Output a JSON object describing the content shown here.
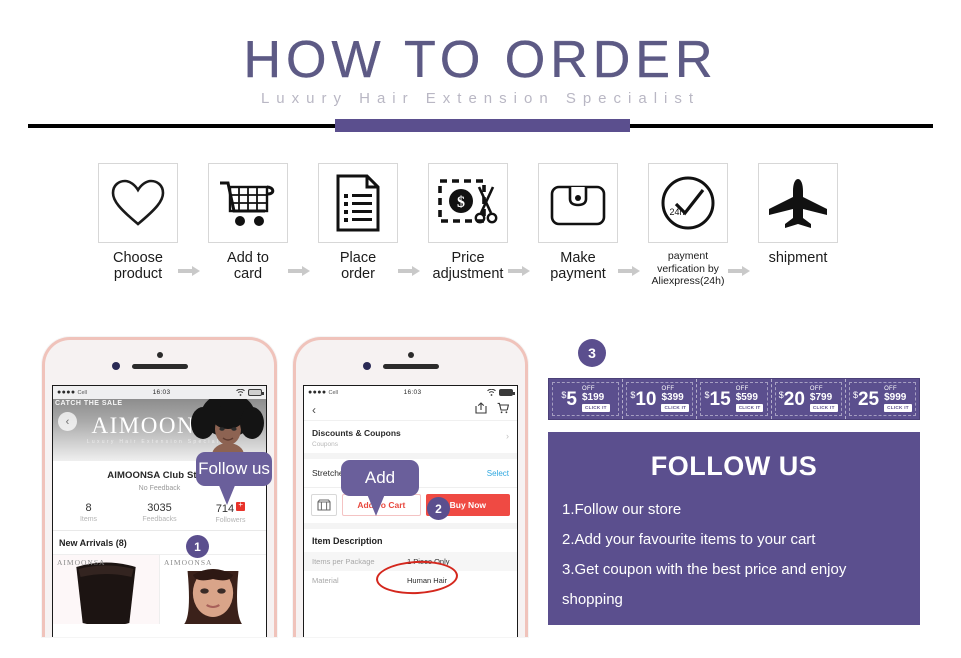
{
  "header": {
    "title": "HOW TO ORDER",
    "subtitle": "Luxury Hair Extension Specialist"
  },
  "steps": [
    {
      "icon": "heart-icon",
      "label_line1": "Choose",
      "label_line2": "product"
    },
    {
      "icon": "shopping-cart-icon",
      "label_line1": "Add to",
      "label_line2": "card"
    },
    {
      "icon": "document-icon",
      "label_line1": "Place",
      "label_line2": "order"
    },
    {
      "icon": "price-cut-icon",
      "label_line1": "Price",
      "label_line2": "adjustment"
    },
    {
      "icon": "wallet-icon",
      "label_line1": "Make",
      "label_line2": "payment"
    },
    {
      "icon": "clock-check-icon",
      "label_line1": "payment",
      "label_line2": "verfication by",
      "label_line3": "Aliexpress(24h)",
      "badge": "24h"
    },
    {
      "icon": "airplane-icon",
      "label_line1": "shipment",
      "label_line2": ""
    }
  ],
  "phone1": {
    "status": {
      "carrier": "Cell",
      "time": "16:03",
      "signal_dots": "●●●●"
    },
    "sale_tag": "CATCH THE SALE",
    "store_banner_name": "AIMOONSA",
    "store_banner_sub": "Luxury Hair Extension Specialist",
    "store_title": "AIMOONSA Club Store",
    "feedback": "No Feedback",
    "stats": [
      {
        "value": "8",
        "label": "Items"
      },
      {
        "value": "3035",
        "label": "Feedbacks"
      },
      {
        "value": "714",
        "label": "Followers",
        "badge": "+"
      }
    ],
    "arrivals": "New Arrivals (8)",
    "watermark": "AIMOONSA",
    "bubble": "Follow us",
    "badge": "1"
  },
  "phone2": {
    "status": {
      "carrier": "Cell",
      "time": "16:03",
      "signal_dots": "●●●●"
    },
    "coupons_title": "Discounts & Coupons",
    "coupons_sub": "Coupons",
    "stretched_label": "Stretched Length",
    "select_label": "Select",
    "add_to_cart": "Add To Cart",
    "buy_now": "Buy Now",
    "desc_title": "Item Description",
    "desc_rows": [
      {
        "key": "Items per Package",
        "value": "1 Piece Only"
      },
      {
        "key": "Material",
        "value": "Human Hair"
      }
    ],
    "bubble": "Add",
    "badge": "2"
  },
  "coupon_strip": {
    "badge": "3",
    "items": [
      {
        "currency": "$",
        "amount": "5",
        "off": "OFF",
        "min": "$199",
        "cta": "CLICK IT"
      },
      {
        "currency": "$",
        "amount": "10",
        "off": "OFF",
        "min": "$399",
        "cta": "CLICK IT"
      },
      {
        "currency": "$",
        "amount": "15",
        "off": "OFF",
        "min": "$599",
        "cta": "CLICK IT"
      },
      {
        "currency": "$",
        "amount": "20",
        "off": "OFF",
        "min": "$799",
        "cta": "CLICK IT"
      },
      {
        "currency": "$",
        "amount": "25",
        "off": "OFF",
        "min": "$999",
        "cta": "CLICK IT"
      }
    ]
  },
  "follow": {
    "title": "FOLLOW US",
    "lines": [
      "1.Follow our store",
      "2.Add your favourite items to your cart",
      "3.Get coupon with the best price and enjoy",
      "shopping"
    ]
  },
  "colors": {
    "purple": "#5b4f8e",
    "bubble_purple": "#6a5f9b",
    "title_purple": "#5d5a85",
    "subtitle_gray": "#b9b7c4",
    "red": "#ef4a43",
    "phone_frame": "#f0c3bb"
  }
}
